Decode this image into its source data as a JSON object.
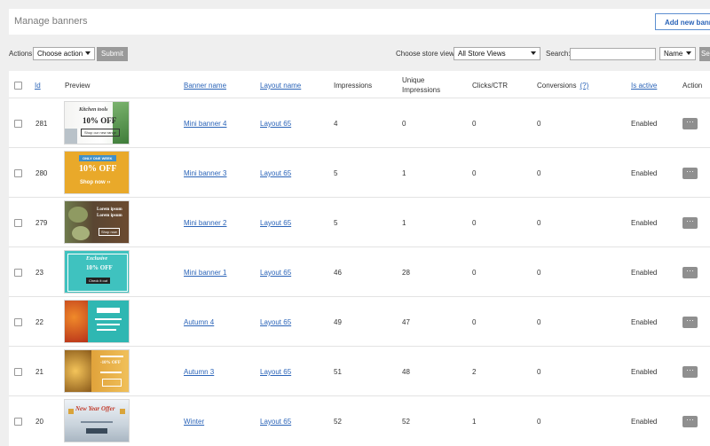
{
  "header": {
    "title": "Manage banners",
    "add_button": "Add new banner"
  },
  "toolbar": {
    "actions_label": "Actions",
    "action_select": "Choose action",
    "submit_label": "Submit",
    "store_label": "Choose store view:",
    "store_select": "All Store Views",
    "search_label": "Search:",
    "search_value": "",
    "search_field": "Name",
    "search_button": "Se"
  },
  "columns": {
    "id": "Id",
    "preview": "Preview",
    "banner_name": "Banner name",
    "layout_name": "Layout name",
    "impressions": "Impressions",
    "unique_1": "Unique",
    "unique_2": "Impressions",
    "clicks": "Clicks/CTR",
    "conversions": "Conversions",
    "conversions_help": "(?)",
    "is_active": "Is active",
    "action": "Action"
  },
  "rows": [
    {
      "id": "281",
      "banner": "Mini banner 4",
      "layout": "Layout 65",
      "impressions": "4",
      "unique": "0",
      "clicks": "0",
      "conversions": "0",
      "status": "Enabled",
      "action": "···",
      "preview": {
        "l1": "Kitchen tools",
        "l2": "10% OFF",
        "l3": "Shop our new range"
      }
    },
    {
      "id": "280",
      "banner": "Mini banner 3",
      "layout": "Layout 65",
      "impressions": "5",
      "unique": "1",
      "clicks": "0",
      "conversions": "0",
      "status": "Enabled",
      "action": "···",
      "preview": {
        "l1": "ONLY ONE WEEK",
        "l2": "10% OFF",
        "l3": "Shop now ››"
      }
    },
    {
      "id": "279",
      "banner": "Mini banner 2",
      "layout": "Layout 65",
      "impressions": "5",
      "unique": "1",
      "clicks": "0",
      "conversions": "0",
      "status": "Enabled",
      "action": "···",
      "preview": {
        "l1": "Lorem ipsum",
        "l2": "Lorem ipsum",
        "l3": "Shop now"
      }
    },
    {
      "id": "23",
      "banner": "Mini banner 1",
      "layout": "Layout 65",
      "impressions": "46",
      "unique": "28",
      "clicks": "0",
      "conversions": "0",
      "status": "Enabled",
      "action": "···",
      "preview": {
        "l1": "Exclusive",
        "l2": "10% OFF",
        "l3": "Check it out"
      }
    },
    {
      "id": "22",
      "banner": "Autumn 4",
      "layout": "Layout 65",
      "impressions": "49",
      "unique": "47",
      "clicks": "0",
      "conversions": "0",
      "status": "Enabled",
      "action": "···",
      "preview": {
        "l1": "",
        "l2": "",
        "l3": ""
      }
    },
    {
      "id": "21",
      "banner": "Autumn 3",
      "layout": "Layout 65",
      "impressions": "51",
      "unique": "48",
      "clicks": "2",
      "conversions": "0",
      "status": "Enabled",
      "action": "···",
      "preview": {
        "l1": "",
        "l2": "-10% OFF",
        "l3": ""
      }
    },
    {
      "id": "20",
      "banner": "Winter",
      "layout": "Layout 65",
      "impressions": "52",
      "unique": "52",
      "clicks": "1",
      "conversions": "0",
      "status": "Enabled",
      "action": "···",
      "preview": {
        "l1": "New Year Offer",
        "l2": "",
        "l3": ""
      }
    }
  ]
}
